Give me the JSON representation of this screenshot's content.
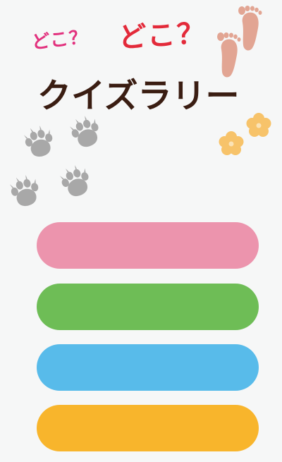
{
  "title": {
    "sub1": "どこ？",
    "sub2": "どこ？",
    "main": "クイズラリー"
  },
  "decorations": {
    "feet_icon": "footprints-icon",
    "paw_icon": "paw-print-icon",
    "flower_icon": "flower-icon"
  },
  "colors": {
    "background": "#f6f7f7",
    "title_sub1": "#e2327e",
    "title_sub2": "#e32a3a",
    "title_main": "#3a1d12",
    "feet": "#e2a593",
    "paw": "#a8a8a8",
    "flower": "#f7c36a"
  },
  "menu": {
    "buttons": [
      {
        "label": "",
        "color": "#ec94ad"
      },
      {
        "label": "",
        "color": "#6ebd56"
      },
      {
        "label": "",
        "color": "#58bbea"
      },
      {
        "label": "",
        "color": "#f8b52c"
      }
    ]
  }
}
